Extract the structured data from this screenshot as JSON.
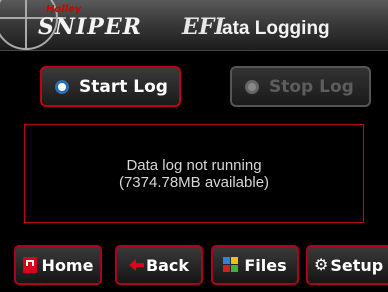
{
  "header": {
    "brand_holley": "Holley",
    "brand_sniper": "SNIPER",
    "brand_efi": "EFI",
    "title": "Data Logging",
    "title_visible": "ata Logging"
  },
  "controls": {
    "start_label": "Start Log",
    "stop_label": "Stop Log"
  },
  "status": {
    "line1": "Data log not running",
    "line2": "(7374.78MB available)"
  },
  "nav": {
    "home": "Home",
    "back": "Back",
    "files": "Files",
    "setup": "Setup"
  },
  "colors": {
    "accent_red": "#c00018",
    "background": "#000000"
  }
}
